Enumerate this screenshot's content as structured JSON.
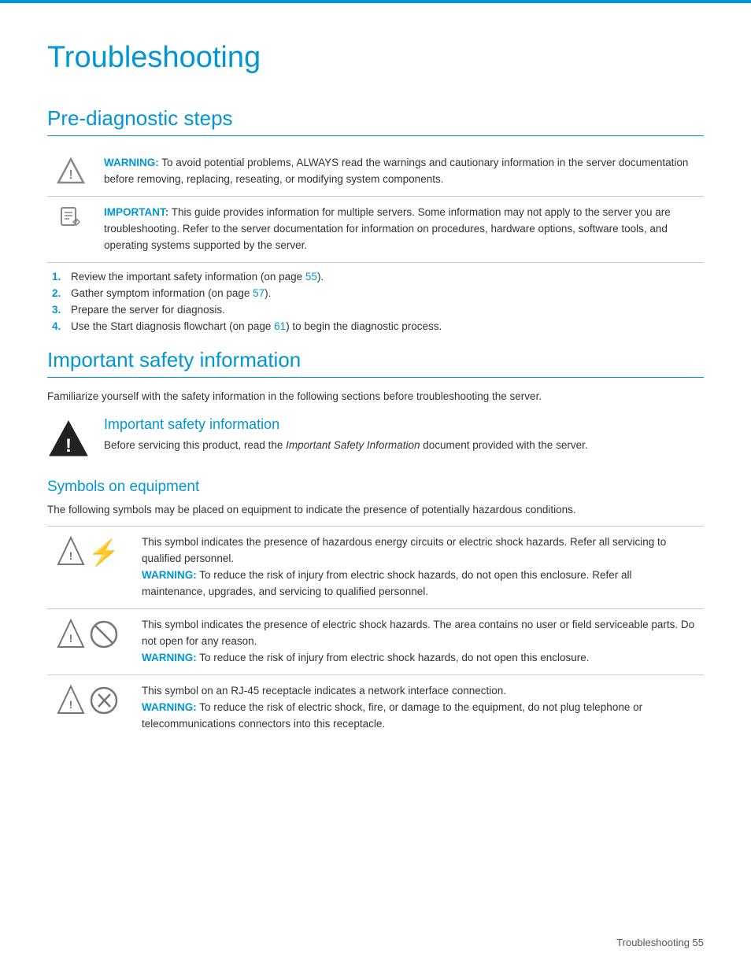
{
  "page": {
    "title": "Troubleshooting",
    "footer": "Troubleshooting    55"
  },
  "prediagnostic": {
    "title": "Pre-diagnostic steps",
    "warning_label": "WARNING:",
    "warning_text": "To avoid potential problems, ALWAYS read the warnings and cautionary information in the server documentation before removing, replacing, reseating, or modifying system components.",
    "important_label": "IMPORTANT:",
    "important_text": "This guide provides information for multiple servers. Some information may not apply to the server you are troubleshooting. Refer to the server documentation for information on procedures, hardware options, software tools, and operating systems supported by the server.",
    "steps": [
      {
        "text": "Review the important safety information (on page ",
        "link": "55",
        "suffix": ")."
      },
      {
        "text": "Gather symptom information (on page ",
        "link": "57",
        "suffix": ")."
      },
      {
        "text": "Prepare the server for diagnosis.",
        "link": "",
        "suffix": ""
      },
      {
        "text": "Use the Start diagnosis flowchart (on page ",
        "link": "61",
        "suffix": ") to begin the diagnostic process."
      }
    ]
  },
  "important_safety": {
    "title": "Important safety information",
    "intro": "Familiarize yourself with the safety information in the following sections before troubleshooting the server.",
    "box_title": "Important safety information",
    "box_text": "Before servicing this product, read the ",
    "box_italic": "Important Safety Information",
    "box_text2": " document provided with the server."
  },
  "symbols": {
    "title": "Symbols on equipment",
    "intro": "The following symbols may be placed on equipment to indicate the presence of potentially hazardous conditions.",
    "rows": [
      {
        "warning_label": "WARNING:",
        "main_text": "This symbol indicates the presence of hazardous energy circuits or electric shock hazards. Refer all servicing to qualified personnel.",
        "warn_text": "To reduce the risk of injury from electric shock hazards, do not open this enclosure. Refer all maintenance, upgrades, and servicing to qualified personnel."
      },
      {
        "warning_label": "WARNING:",
        "main_text": "This symbol indicates the presence of electric shock hazards. The area contains no user or field serviceable parts. Do not open for any reason.",
        "warn_text": "To reduce the risk of injury from electric shock hazards, do not open this enclosure."
      },
      {
        "warning_label": "WARNING:",
        "main_text": "This symbol on an RJ-45 receptacle indicates a network interface connection.",
        "warn_text": "To reduce the risk of electric shock, fire, or damage to the equipment, do not plug telephone or telecommunications connectors into this receptacle."
      }
    ]
  }
}
